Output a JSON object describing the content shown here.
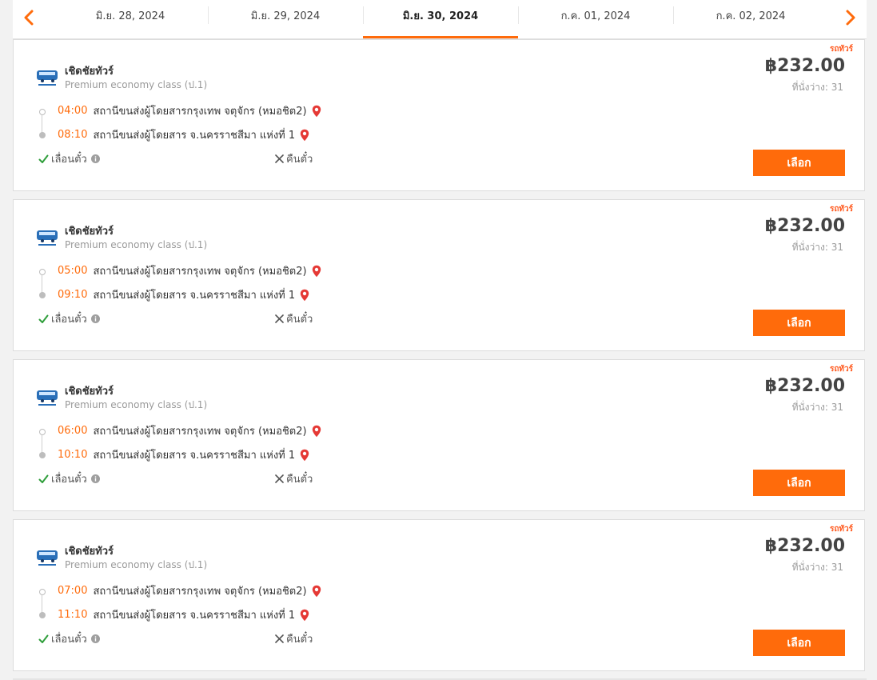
{
  "date_nav": {
    "prev_icon": "chevron-left-icon",
    "next_icon": "chevron-right-icon",
    "accent_color": "#ff6b0b",
    "dates": [
      {
        "label": "มิ.ย. 28, 2024",
        "active": false
      },
      {
        "label": "มิ.ย. 29, 2024",
        "active": false
      },
      {
        "label": "มิ.ย. 30, 2024",
        "active": true
      },
      {
        "label": "ก.ค. 01, 2024",
        "active": false
      },
      {
        "label": "ก.ค. 02, 2024",
        "active": false
      }
    ]
  },
  "trips": [
    {
      "tag": "รถทัวร์",
      "operator": "เชิดชัยทัวร์",
      "bus_class": "Premium economy class (ป.1)",
      "price": "฿232.00",
      "seats": "ที่นั่งว่าง: 31",
      "depart_time": "04:00",
      "depart_station": "สถานีขนส่งผู้โดยสารกรุงเทพ จตุจักร (หมอชิต2)",
      "arrive_time": "08:10",
      "arrive_station": "สถานีขนส่งผู้โดยสาร จ.นครราชสีมา แห่งที่ 1",
      "reschedule": "เลื่อนตั๋ว",
      "refund": "คืนตั๋ว",
      "select_label": "เลือก"
    },
    {
      "tag": "รถทัวร์",
      "operator": "เชิดชัยทัวร์",
      "bus_class": "Premium economy class (ป.1)",
      "price": "฿232.00",
      "seats": "ที่นั่งว่าง: 31",
      "depart_time": "05:00",
      "depart_station": "สถานีขนส่งผู้โดยสารกรุงเทพ จตุจักร (หมอชิต2)",
      "arrive_time": "09:10",
      "arrive_station": "สถานีขนส่งผู้โดยสาร จ.นครราชสีมา แห่งที่ 1",
      "reschedule": "เลื่อนตั๋ว",
      "refund": "คืนตั๋ว",
      "select_label": "เลือก"
    },
    {
      "tag": "รถทัวร์",
      "operator": "เชิดชัยทัวร์",
      "bus_class": "Premium economy class (ป.1)",
      "price": "฿232.00",
      "seats": "ที่นั่งว่าง: 31",
      "depart_time": "06:00",
      "depart_station": "สถานีขนส่งผู้โดยสารกรุงเทพ จตุจักร (หมอชิต2)",
      "arrive_time": "10:10",
      "arrive_station": "สถานีขนส่งผู้โดยสาร จ.นครราชสีมา แห่งที่ 1",
      "reschedule": "เลื่อนตั๋ว",
      "refund": "คืนตั๋ว",
      "select_label": "เลือก"
    },
    {
      "tag": "รถทัวร์",
      "operator": "เชิดชัยทัวร์",
      "bus_class": "Premium economy class (ป.1)",
      "price": "฿232.00",
      "seats": "ที่นั่งว่าง: 31",
      "depart_time": "07:00",
      "depart_station": "สถานีขนส่งผู้โดยสารกรุงเทพ จตุจักร (หมอชิต2)",
      "arrive_time": "11:10",
      "arrive_station": "สถานีขนส่งผู้โดยสาร จ.นครราชสีมา แห่งที่ 1",
      "reschedule": "เลื่อนตั๋ว",
      "refund": "คืนตั๋ว",
      "select_label": "เลือก"
    }
  ]
}
